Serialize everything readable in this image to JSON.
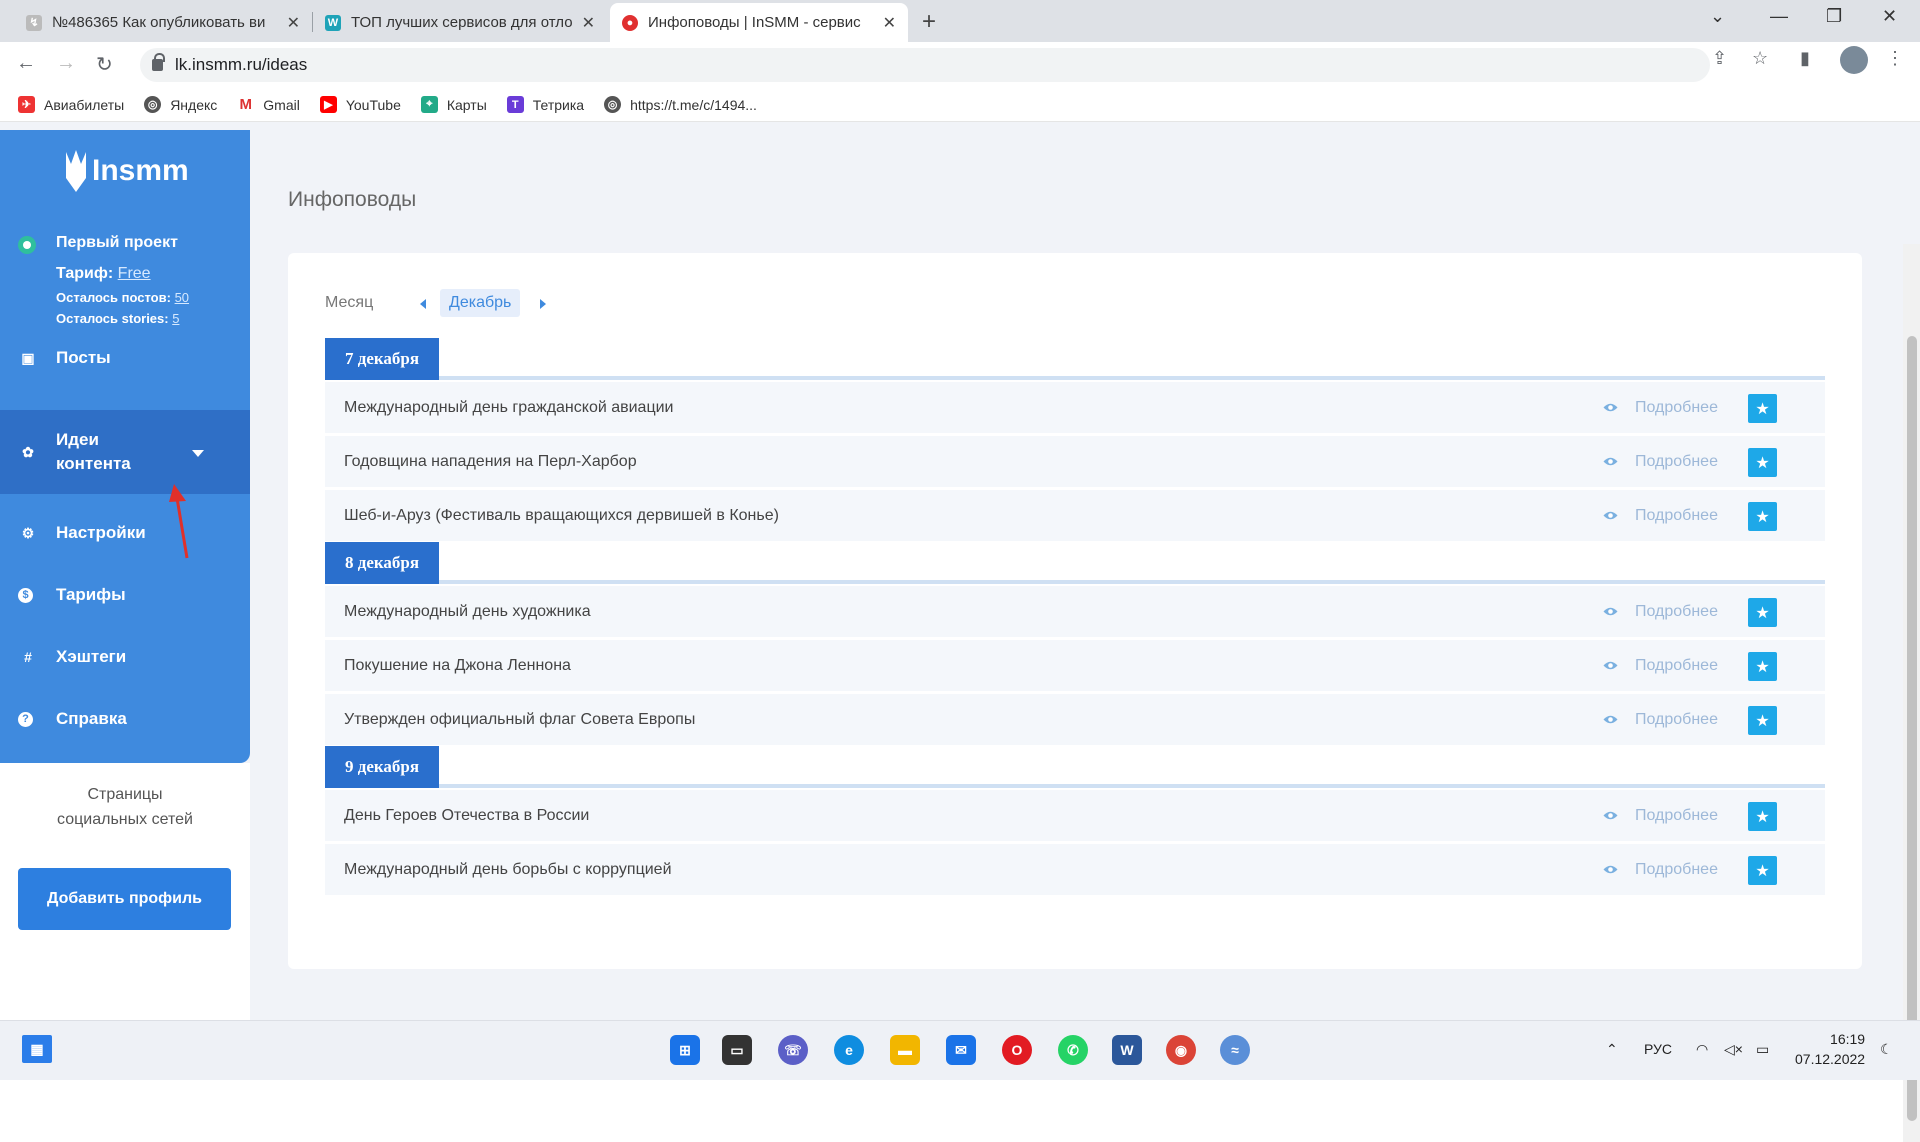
{
  "browser": {
    "tabs": [
      {
        "title": "№486365 Как опубликовать ви",
        "fav": "↯",
        "color": "#888"
      },
      {
        "title": "ТОП лучших сервисов для отло",
        "fav": "W",
        "color": "#1fa3b8"
      },
      {
        "title": "Инфоповоды | InSMM - сервис",
        "fav": "●",
        "color": "#e03030"
      }
    ],
    "url": "lk.insmm.ru/ideas",
    "bookmarks": [
      {
        "label": "Авиабилеты",
        "color": "#e33"
      },
      {
        "label": "Яндекс",
        "color": "#555"
      },
      {
        "label": "Gmail",
        "color": "#d33"
      },
      {
        "label": "YouTube",
        "color": "#f00"
      },
      {
        "label": "Карты",
        "color": "#2a8"
      },
      {
        "label": "Тетрика",
        "color": "#6a3cd8"
      },
      {
        "label": "https://t.me/c/1494...",
        "color": "#555"
      }
    ]
  },
  "sidebar": {
    "logo": "Insmm",
    "project_name": "Первый проект",
    "tarif_label": "Тариф:",
    "tarif_value": "Free",
    "posts_left_label": "Осталось постов:",
    "posts_left_value": "50",
    "stories_left_label": "Осталось stories:",
    "stories_left_value": "5",
    "menu": [
      {
        "label": "Посты",
        "icon": "image-icon"
      },
      {
        "label": "Идеи контента",
        "icon": "palette-icon"
      },
      {
        "label": "Настройки",
        "icon": "gear-icon"
      },
      {
        "label": "Тарифы",
        "icon": "dollar-icon"
      },
      {
        "label": "Хэштеги",
        "icon": "hashtag-icon"
      },
      {
        "label": "Справка",
        "icon": "help-icon"
      }
    ],
    "social_title_line1": "Страницы",
    "social_title_line2": "социальных сетей",
    "add_profile": "Добавить профиль"
  },
  "main": {
    "title": "Инфоповоды",
    "month_label": "Месяц",
    "month_value": "Декабрь",
    "more_label": "Подробнее",
    "days": [
      {
        "date": "7 декабря",
        "events": [
          "Международный день гражданской авиации",
          "Годовщина нападения на Перл-Харбор",
          "Шеб-и-Аруз (Фестиваль вращающихся дервишей в Конье)"
        ]
      },
      {
        "date": "8 декабря",
        "events": [
          "Международный день художника",
          "Покушение на Джона Леннона",
          "Утвержден официальный флаг Совета Европы"
        ]
      },
      {
        "date": "9 декабря",
        "events": [
          "День Героев Отечества в России",
          "Международный день борьбы с коррупцией"
        ]
      }
    ]
  },
  "taskbar": {
    "lang": "РУС",
    "time": "16:19",
    "date": "07.12.2022"
  }
}
